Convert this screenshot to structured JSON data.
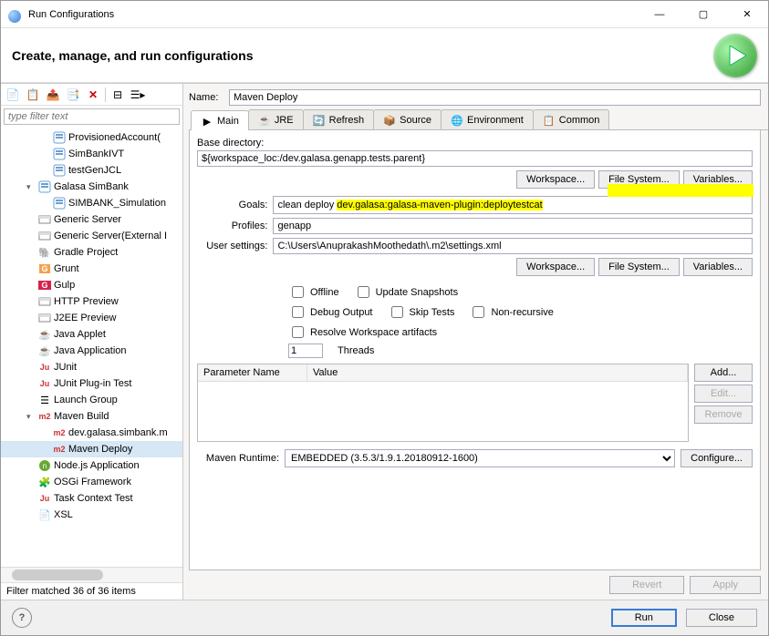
{
  "window": {
    "title": "Run Configurations"
  },
  "header": {
    "title": "Create, manage, and run configurations"
  },
  "leftPane": {
    "filterPlaceholder": "type filter text",
    "items": [
      {
        "label": "ProvisionedAccount(",
        "icon": "cfg",
        "indent": 2
      },
      {
        "label": "SimBankIVT",
        "icon": "cfg",
        "indent": 2
      },
      {
        "label": "testGenJCL",
        "icon": "cfg",
        "indent": 2
      },
      {
        "label": "Galasa SimBank",
        "icon": "cfg",
        "indent": 1,
        "caret": "▾"
      },
      {
        "label": "SIMBANK_Simulation",
        "icon": "cfg",
        "indent": 2
      },
      {
        "label": "Generic Server",
        "icon": "srv",
        "indent": 1
      },
      {
        "label": "Generic Server(External I",
        "icon": "srv",
        "indent": 1
      },
      {
        "label": "Gradle Project",
        "icon": "gradle",
        "indent": 1
      },
      {
        "label": "Grunt",
        "icon": "grunt",
        "indent": 1
      },
      {
        "label": "Gulp",
        "icon": "gulp",
        "indent": 1
      },
      {
        "label": "HTTP Preview",
        "icon": "srv",
        "indent": 1
      },
      {
        "label": "J2EE Preview",
        "icon": "srv",
        "indent": 1
      },
      {
        "label": "Java Applet",
        "icon": "java",
        "indent": 1
      },
      {
        "label": "Java Application",
        "icon": "java",
        "indent": 1
      },
      {
        "label": "JUnit",
        "icon": "junit",
        "indent": 1
      },
      {
        "label": "JUnit Plug-in Test",
        "icon": "junit",
        "indent": 1
      },
      {
        "label": "Launch Group",
        "icon": "grp",
        "indent": 1
      },
      {
        "label": "Maven Build",
        "icon": "m2",
        "indent": 1,
        "caret": "▾"
      },
      {
        "label": "dev.galasa.simbank.m",
        "icon": "m2r",
        "indent": 2
      },
      {
        "label": "Maven Deploy",
        "icon": "m2r",
        "indent": 2,
        "selected": true
      },
      {
        "label": "Node.js Application",
        "icon": "node",
        "indent": 1
      },
      {
        "label": "OSGi Framework",
        "icon": "osgi",
        "indent": 1
      },
      {
        "label": "Task Context Test",
        "icon": "junit",
        "indent": 1
      },
      {
        "label": "XSL",
        "icon": "xsl",
        "indent": 1
      }
    ],
    "filterStatus": "Filter matched 36 of 36 items"
  },
  "nameRow": {
    "label": "Name:",
    "value": "Maven Deploy"
  },
  "tabs": [
    "Main",
    "JRE",
    "Refresh",
    "Source",
    "Environment",
    "Common"
  ],
  "mainTab": {
    "baseDirLabel": "Base directory:",
    "baseDir": "${workspace_loc:/dev.galasa.genapp.tests.parent}",
    "workspaceBtn": "Workspace...",
    "fileSystemBtn": "File System...",
    "variablesBtn": "Variables...",
    "goalsLabel": "Goals:",
    "goalsPrefix": "clean deploy ",
    "goalsHighlighted": "dev.galasa:galasa-maven-plugin:deploytestcat",
    "profilesLabel": "Profiles:",
    "profiles": "genapp",
    "userSettingsLabel": "User settings:",
    "userSettings": "C:\\Users\\AnuprakashMoothedath\\.m2\\settings.xml",
    "cbOffline": "Offline",
    "cbUpdateSnapshots": "Update Snapshots",
    "cbDebugOutput": "Debug Output",
    "cbSkipTests": "Skip Tests",
    "cbNonRecursive": "Non-recursive",
    "cbResolveWs": "Resolve Workspace artifacts",
    "threadsValue": "1",
    "threadsLabel": "Threads",
    "paramNameCol": "Parameter Name",
    "paramValueCol": "Value",
    "addBtn": "Add...",
    "editBtn": "Edit...",
    "removeBtn": "Remove",
    "runtimeLabel": "Maven Runtime:",
    "runtimeValue": "EMBEDDED (3.5.3/1.9.1.20180912-1600)",
    "configureBtn": "Configure..."
  },
  "actions": {
    "revert": "Revert",
    "apply": "Apply",
    "run": "Run",
    "close": "Close"
  }
}
